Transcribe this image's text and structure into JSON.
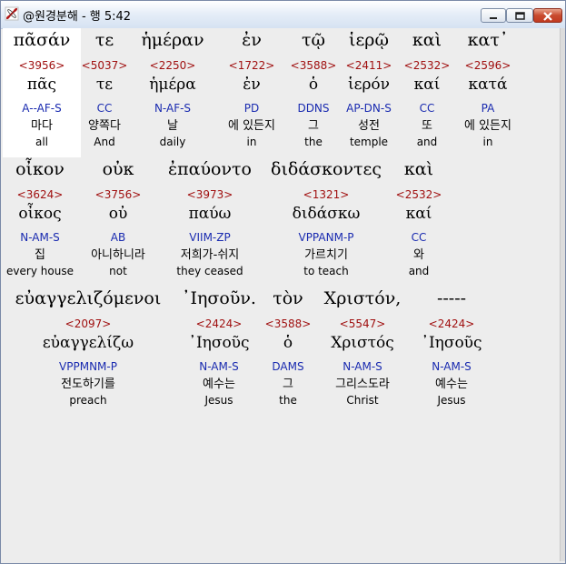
{
  "window": {
    "title": "@원경분해 - 행 5:42",
    "colors": {
      "strongs": "#a01010",
      "parsing": "#1a2bb0",
      "selected_bg": "#ffffff"
    }
  },
  "icons": {
    "app": "kayak-paddle-icon",
    "minimize": "minimize-icon",
    "maximize": "maximize-icon",
    "close": "close-icon"
  },
  "rows": [
    {
      "words": [
        {
          "word": "πᾶσάν",
          "strongs": "<3956>",
          "lemma": "πᾶς",
          "parsing": "A--AF-S",
          "korean": "마다",
          "english": "all",
          "selected": true
        },
        {
          "word": "τε",
          "strongs": "<5037>",
          "lemma": "τε",
          "parsing": "CC",
          "korean": "양쪽다",
          "english": "And"
        },
        {
          "word": "ἡμέραν",
          "strongs": "<2250>",
          "lemma": "ἡμέρα",
          "parsing": "N-AF-S",
          "korean": "날",
          "english": "daily"
        },
        {
          "word": "ἐν",
          "strongs": "<1722>",
          "lemma": "ἐν",
          "parsing": "PD",
          "korean": "에 있든지",
          "english": "in"
        },
        {
          "word": "τῷ",
          "strongs": "<3588>",
          "lemma": "ὁ",
          "parsing": "DDNS",
          "korean": "그",
          "english": "the"
        },
        {
          "word": "ἱερῷ",
          "strongs": "<2411>",
          "lemma": "ἱερόν",
          "parsing": "AP-DN-S",
          "korean": "성전",
          "english": "temple"
        },
        {
          "word": "καὶ",
          "strongs": "<2532>",
          "lemma": "καί",
          "parsing": "CC",
          "korean": "또",
          "english": "and"
        },
        {
          "word": "κατ᾽",
          "strongs": "<2596>",
          "lemma": "κατά",
          "parsing": "PA",
          "korean": "에 있든지",
          "english": "in"
        }
      ]
    },
    {
      "words": [
        {
          "word": "οἶκον",
          "strongs": "<3624>",
          "lemma": "οἶκος",
          "parsing": "N-AM-S",
          "korean": "집",
          "english": "every house"
        },
        {
          "word": "οὐκ",
          "strongs": "<3756>",
          "lemma": "οὐ",
          "parsing": "AB",
          "korean": "아니하니라",
          "english": "not"
        },
        {
          "word": "ἐπαύοντο",
          "strongs": "<3973>",
          "lemma": "παύω",
          "parsing": "VIIM-ZP",
          "korean": "저희가-쉬지",
          "english": "they ceased"
        },
        {
          "word": "διδάσκοντες",
          "strongs": "<1321>",
          "lemma": "διδάσκω",
          "parsing": "VPPANM-P",
          "korean": "가르치기",
          "english": "to teach"
        },
        {
          "word": "καὶ",
          "strongs": "<2532>",
          "lemma": "καί",
          "parsing": "CC",
          "korean": "와",
          "english": "and"
        }
      ]
    },
    {
      "words": [
        {
          "word": "εὐαγγελιζόμενοι",
          "strongs": "<2097>",
          "lemma": "εὐαγγελίζω",
          "parsing": "VPPMNM-P",
          "korean": "전도하기를",
          "english": "preach"
        },
        {
          "word": "᾽Ιησοῦν.",
          "strongs": "<2424>",
          "lemma": "᾽Ιησοῦς",
          "parsing": "N-AM-S",
          "korean": "예수는",
          "english": "Jesus"
        },
        {
          "word": "τὸν",
          "strongs": "<3588>",
          "lemma": "ὁ",
          "parsing": "DAMS",
          "korean": "그",
          "english": "the"
        },
        {
          "word": "Χριστόν,",
          "strongs": "<5547>",
          "lemma": "Χριστός",
          "parsing": "N-AM-S",
          "korean": "그리스도라",
          "english": "Christ"
        },
        {
          "word": "-----",
          "strongs": "<2424>",
          "lemma": "᾽Ιησοῦς",
          "parsing": "N-AM-S",
          "korean": "예수는",
          "english": "Jesus"
        }
      ]
    }
  ]
}
